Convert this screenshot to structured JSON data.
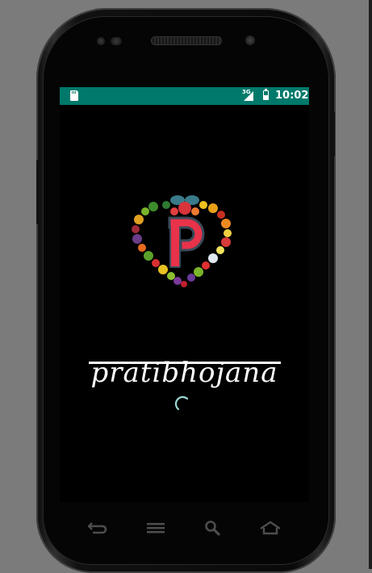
{
  "status_bar": {
    "network_type": "3G",
    "time": "10:02",
    "icons": [
      "sd-card-icon",
      "signal-icon",
      "battery-icon"
    ],
    "background": "#00796b"
  },
  "splash": {
    "app_name": "pratibhojana",
    "logo_letter": "P",
    "logo": "heart-of-fruits-and-vegetables-logo",
    "loading": true
  },
  "nav_bar": {
    "buttons": [
      "back-icon",
      "menu-icon",
      "search-icon",
      "home-icon"
    ]
  },
  "colors": {
    "status_bar": "#00796b",
    "screen": "#000000",
    "logo_accent": "#e8334a",
    "spinner": "#9ad8d3"
  }
}
